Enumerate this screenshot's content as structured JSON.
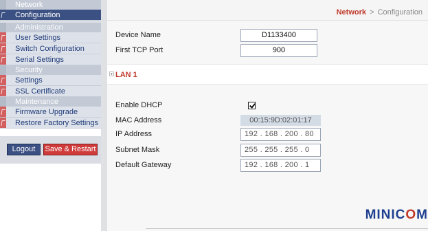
{
  "sidebar": {
    "sections": [
      {
        "header": "Network",
        "items": [
          {
            "label": "Configuration",
            "active": true
          }
        ]
      },
      {
        "header": "Administration",
        "items": [
          {
            "label": "User Settings"
          },
          {
            "label": "Switch Configuration"
          },
          {
            "label": "Serial Settings"
          }
        ]
      },
      {
        "header": "Security",
        "items": [
          {
            "label": "Settings"
          },
          {
            "label": "SSL Certificate"
          }
        ]
      },
      {
        "header": "Maintenance",
        "items": [
          {
            "label": "Firmware Upgrade"
          },
          {
            "label": "Restore Factory Settings"
          }
        ]
      }
    ],
    "buttons": {
      "logout": "Logout",
      "save_restart": "Save & Restart"
    }
  },
  "breadcrumb": {
    "section": "Network",
    "separator": ">",
    "page": "Configuration"
  },
  "device": {
    "name_label": "Device Name",
    "name_value": "D1133400",
    "port_label": "First TCP Port",
    "port_value": "900"
  },
  "lan": {
    "title": "LAN 1",
    "dhcp_label": "Enable DHCP",
    "dhcp_checked": true,
    "mac_label": "MAC Address",
    "mac_value": "00:15:9D:02:01:17",
    "ip_label": "IP Address",
    "ip_value": "192 . 168 . 200 . 80",
    "subnet_label": "Subnet Mask",
    "subnet_value": "255 . 255 . 255 . 0",
    "gateway_label": "Default Gateway",
    "gateway_value": "192 . 168 . 200 . 1"
  },
  "logo": {
    "part1": "MINIC",
    "part2": "O",
    "part3": "M"
  },
  "colors": {
    "accent_red": "#c0392b",
    "nav_active": "#3b5083",
    "link_blue": "#1f3a78",
    "logo_blue": "#1e3f8f"
  }
}
